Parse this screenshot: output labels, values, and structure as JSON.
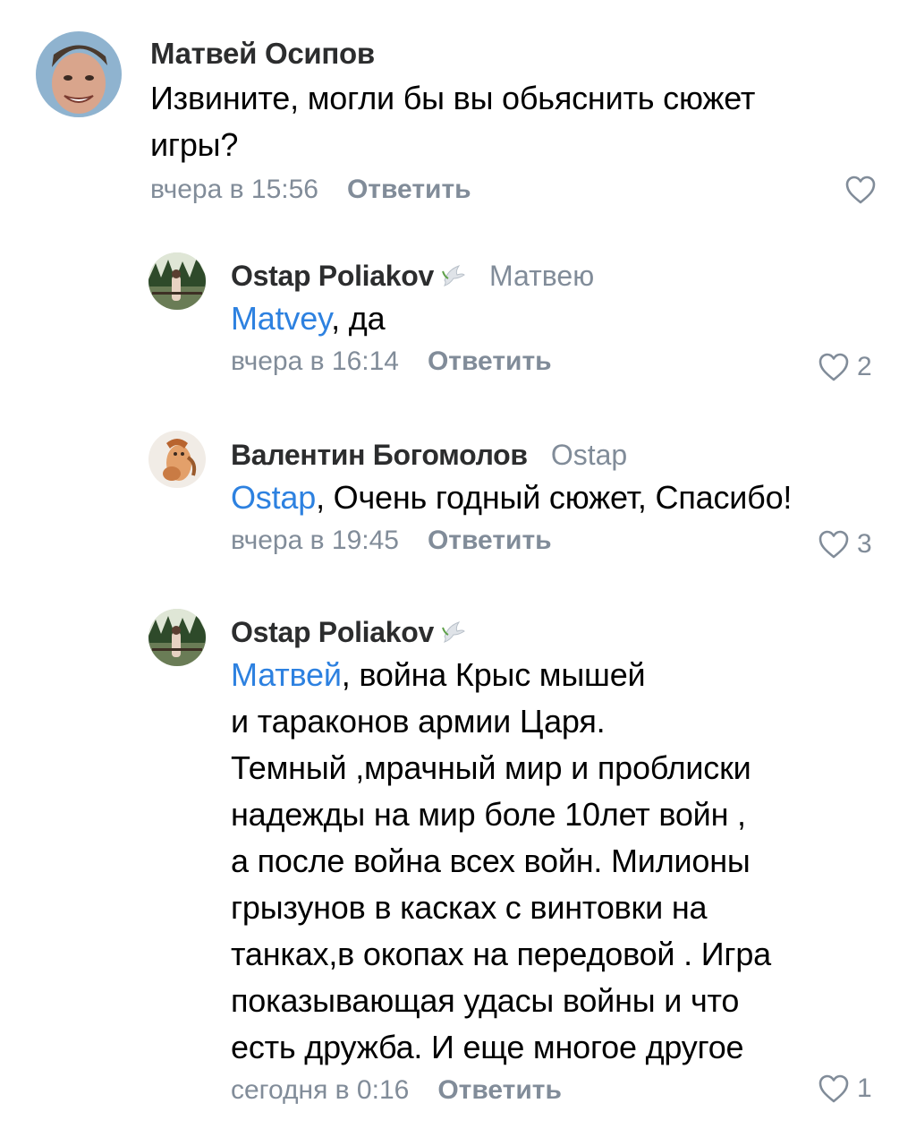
{
  "comments": [
    {
      "author": "Матвей Осипов",
      "reply_to": "",
      "mention": "",
      "text_lines": [
        "Извините, могли бы вы обьяснить сюжет",
        "игры?"
      ],
      "time": "вчера в 15:56",
      "reply_label": "Ответить",
      "likes": ""
    },
    {
      "author": "Ostap Poliakov",
      "reply_to": "Матвею",
      "mention": "Matvey",
      "text_lines": [
        ", да"
      ],
      "time": "вчера в 16:14",
      "reply_label": "Ответить",
      "likes": "2"
    },
    {
      "author": "Валентин Богомолов",
      "reply_to": "Ostap",
      "mention": "Ostap",
      "text_lines": [
        ", Очень годный сюжет, Спасибо!"
      ],
      "time": "вчера в 19:45",
      "reply_label": "Ответить",
      "likes": "3"
    },
    {
      "author": "Ostap Poliakov",
      "reply_to": "",
      "mention": "Матвей",
      "text_lines": [
        ", война Крыс мышей",
        "и тараконов армии Царя.",
        "Темный ,мрачный мир и проблиски",
        "надежды на мир боле 10лет войн ,",
        "а после война всех войн. Милионы",
        "грызунов в касках с винтовки на",
        "танках,в окопах на передовой . Игра",
        "показывающая удасы войны и что",
        "есть дружба. И еще многое другое"
      ],
      "time": "сегодня в 0:16",
      "reply_label": "Ответить",
      "likes": "1"
    }
  ],
  "colors": {
    "text": "#000000",
    "author": "#2c2d2e",
    "secondary": "#818c99",
    "link": "#2d81e0"
  },
  "icons": {
    "like": "heart-outline-icon",
    "badge": "dove-icon"
  }
}
